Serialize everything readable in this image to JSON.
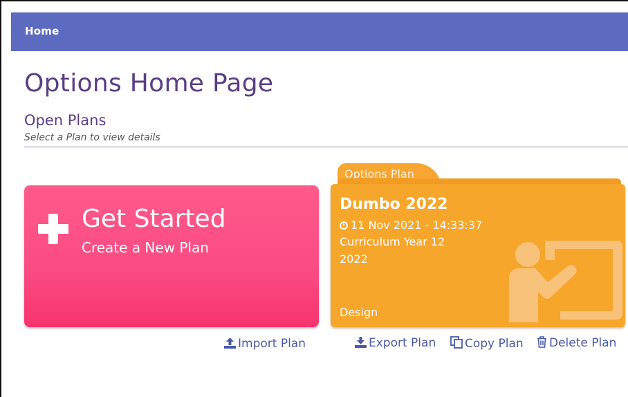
{
  "topbar": {
    "home_label": "Home"
  },
  "page": {
    "title": "Options Home Page",
    "section_title": "Open Plans",
    "section_subtitle": "Select a Plan to view details"
  },
  "get_started": {
    "title": "Get Started",
    "subtitle": "Create a New Plan",
    "icon": "plus-icon",
    "color": "#fb4b82"
  },
  "plan_card": {
    "tab_label": "Options Plan",
    "name": "Dumbo 2022",
    "date": "11 Nov 2021 - 14:33:37",
    "curriculum": "Curriculum Year 12",
    "year": "2022",
    "status": "Design",
    "icon": "teacher-icon",
    "color": "#f6a62b"
  },
  "actions": {
    "import": "Import Plan",
    "export": "Export Plan",
    "copy": "Copy Plan",
    "delete": "Delete Plan"
  },
  "colors": {
    "topbar": "#5c6bc0",
    "heading": "#5b3d86",
    "link": "#4a5aa8"
  }
}
